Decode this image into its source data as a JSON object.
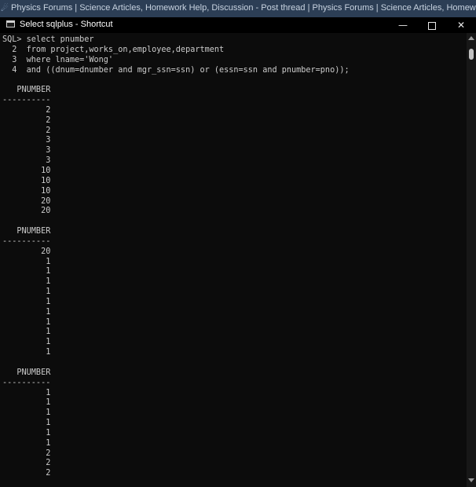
{
  "browser_tab": {
    "text": "Physics Forums | Science Articles, Homework Help, Discussion - Post thread | Physics Forums | Science Articles, Homework Help, Discussion"
  },
  "window": {
    "title": "Select sqlplus - Shortcut",
    "minimize_glyph": "—",
    "close_glyph": "✕"
  },
  "console": {
    "lines": [
      "SQL> select pnumber",
      "  2  from project,works_on,employee,department",
      "  3  where lname='Wong'",
      "  4  and ((dnum=dnumber and mgr_ssn=ssn) or (essn=ssn and pnumber=pno));",
      "",
      "   PNUMBER",
      "----------",
      "         2",
      "         2",
      "         2",
      "         3",
      "         3",
      "         3",
      "        10",
      "        10",
      "        10",
      "        20",
      "        20",
      "",
      "   PNUMBER",
      "----------",
      "        20",
      "         1",
      "         1",
      "         1",
      "         1",
      "         1",
      "         1",
      "         1",
      "         1",
      "         1",
      "         1",
      "",
      "   PNUMBER",
      "----------",
      "         1",
      "         1",
      "         1",
      "         1",
      "         1",
      "         1",
      "         2",
      "         2",
      "         2"
    ]
  }
}
